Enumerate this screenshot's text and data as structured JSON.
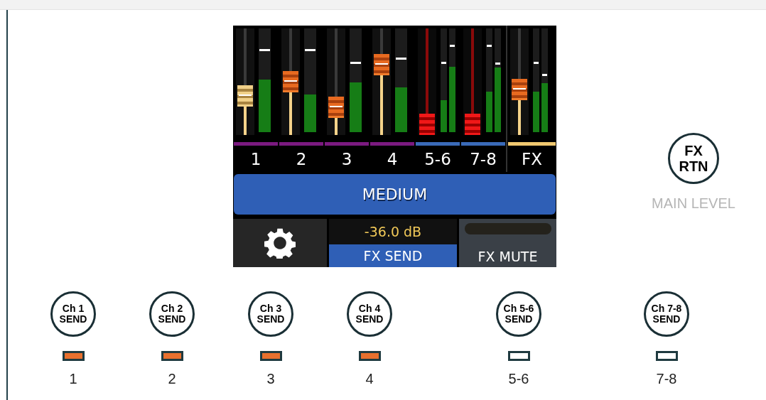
{
  "mixer": {
    "channels": [
      {
        "label": "1",
        "kind": "input",
        "color": "#7b1a80",
        "selected": true,
        "muted": false,
        "fader": {
          "level": 0.37
        },
        "meters": [
          {
            "level": 0.51,
            "peak": {
              "level": 0.78
            }
          }
        ]
      },
      {
        "label": "2",
        "kind": "input",
        "color": "#7b1a80",
        "selected": false,
        "muted": false,
        "fader": {
          "level": 0.5
        },
        "meters": [
          {
            "level": 0.36,
            "peak": {
              "level": 0.78
            }
          }
        ]
      },
      {
        "label": "3",
        "kind": "input",
        "color": "#7b1a80",
        "selected": false,
        "muted": false,
        "fader": {
          "level": 0.26
        },
        "meters": [
          {
            "level": 0.48,
            "peak": {
              "level": 0.66
            }
          }
        ]
      },
      {
        "label": "4",
        "kind": "input",
        "color": "#7b1a80",
        "selected": false,
        "muted": false,
        "fader": {
          "level": 0.66
        },
        "meters": [
          {
            "level": 0.43,
            "peak": {
              "level": 0.7
            }
          }
        ]
      },
      {
        "label": "5-6",
        "kind": "input",
        "color": "#3a6ab8",
        "selected": false,
        "muted": true,
        "fader": {
          "level": 0.1
        },
        "meters": [
          {
            "level": 0.31,
            "peak": {
              "level": 0.66
            }
          },
          {
            "level": 0.63,
            "peak": {
              "level": 0.82
            }
          }
        ]
      },
      {
        "label": "7-8",
        "kind": "input",
        "color": "#3a6ab8",
        "selected": false,
        "muted": true,
        "fader": {
          "level": 0.1
        },
        "meters": [
          {
            "level": 0.39,
            "peak": {
              "level": 0.82
            }
          },
          {
            "level": 0.62,
            "peak": {
              "level": 0.65
            }
          }
        ]
      },
      {
        "label": "FX",
        "kind": "return",
        "color": "#f0c870",
        "selected": false,
        "muted": false,
        "fader": {
          "level": 0.43
        },
        "meters": [
          {
            "level": 0.39,
            "peak": {
              "level": 0.66
            }
          },
          {
            "level": 0.47,
            "peak": {
              "level": 0.54
            }
          }
        ]
      }
    ],
    "preset_button": {
      "label": "MEDIUM"
    },
    "fx_send": {
      "value": "-36.0 dB",
      "label": "FX SEND"
    },
    "fx_mute": {
      "label": "FX MUTE",
      "on": false
    }
  },
  "fx_return": {
    "label": "FX RTN",
    "caption": "MAIN LEVEL"
  },
  "sends": [
    {
      "label": "Ch 1 SEND",
      "on": true,
      "number": "1"
    },
    {
      "label": "Ch 2 SEND",
      "on": true,
      "number": "2"
    },
    {
      "label": "Ch 3 SEND",
      "on": true,
      "number": "3"
    },
    {
      "label": "Ch 4 SEND",
      "on": true,
      "number": "4"
    },
    {
      "label": "Ch 5-6 SEND",
      "on": false,
      "number": "5-6"
    },
    {
      "label": "Ch 7-8 SEND",
      "on": false,
      "number": "7-8"
    }
  ]
}
